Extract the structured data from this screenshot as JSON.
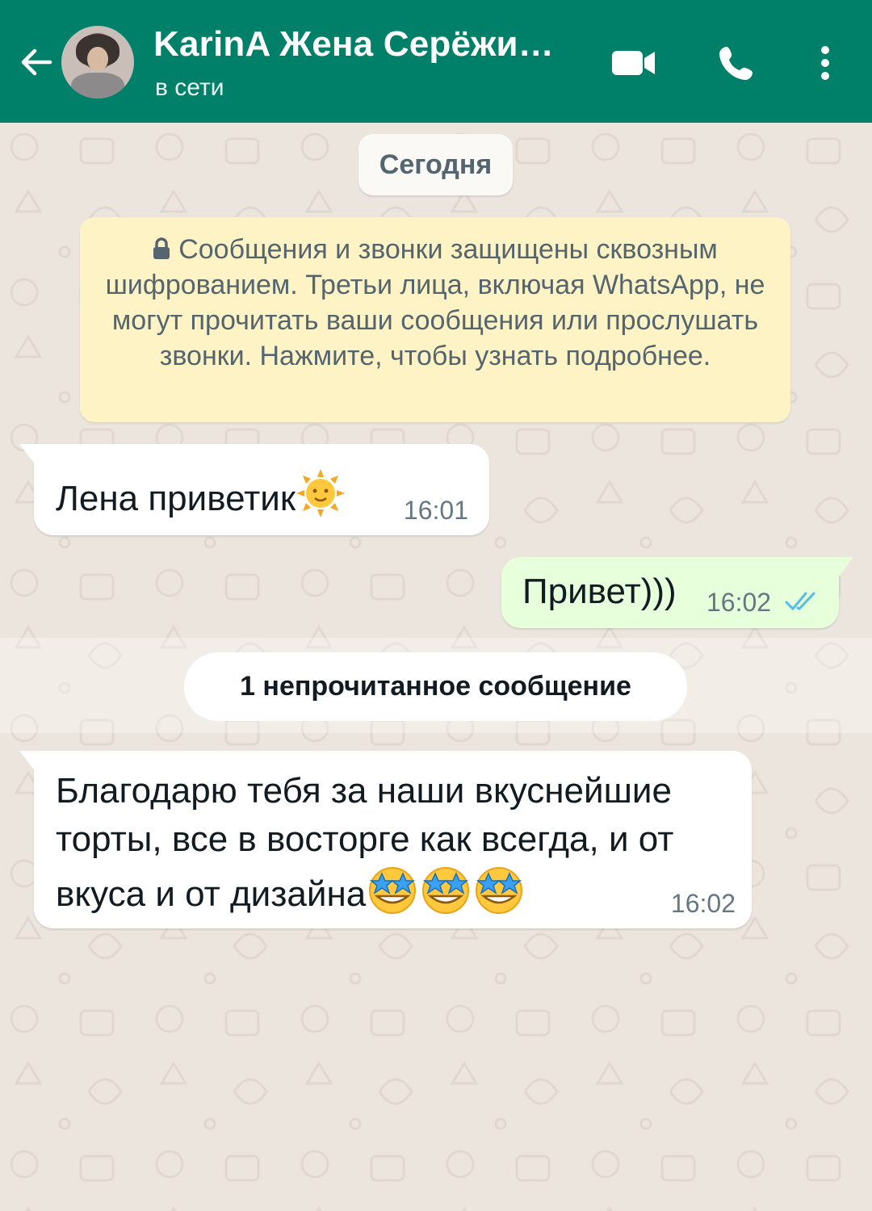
{
  "header": {
    "contact_name": "KarinA Жена Серёжи…",
    "status": "в сети",
    "icons": [
      "back-arrow-icon",
      "video-call-icon",
      "phone-icon",
      "more-vert-icon"
    ],
    "background_color": "#008069"
  },
  "chat": {
    "date_chip": "Сегодня",
    "encryption_notice": "Сообщения и звонки защищены сквозным шифрованием. Третьи лица, включая WhatsApp, не могут прочитать ваши сообщения или прослушать звонки. Нажмите, чтобы узнать подробнее.",
    "messages": [
      {
        "direction": "incoming",
        "text": "Лена приветик",
        "emoji": "sun-with-face-emoji",
        "time": "16:01"
      },
      {
        "direction": "outgoing",
        "text": "Привет)))",
        "time": "16:02",
        "status": "read-ticks-icon"
      },
      {
        "direction": "incoming",
        "text": "Благодарю тебя за наши вкуснейшие торты, все в восторге как всегда, и от вкуса и от дизайна",
        "emoji": "star-struck-emoji x3",
        "time": "16:02"
      }
    ],
    "unread_divider": "1 непрочитанное сообщение",
    "colors": {
      "wallpaper": "#ECE5DD",
      "incoming_bubble": "#FFFFFF",
      "outgoing_bubble": "#E7FFDB",
      "notice_bubble": "#FDF3C5",
      "read_ticks": "#53BDEB"
    }
  }
}
